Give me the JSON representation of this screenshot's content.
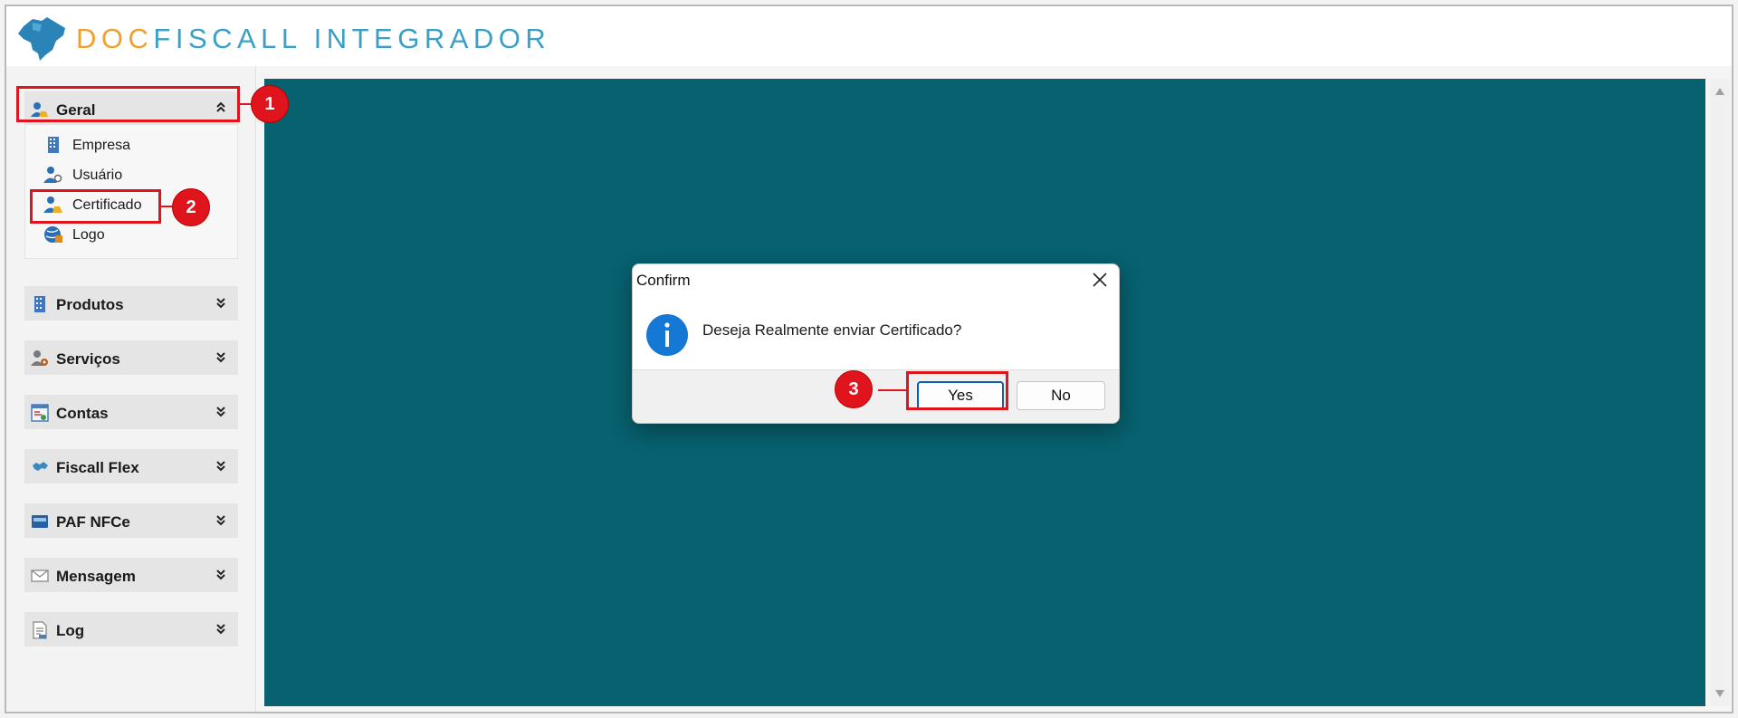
{
  "app": {
    "brand_accent": "DOC",
    "brand_rest": "FISCALL INTEGRADOR",
    "colors": {
      "accent_orange": "#f0a02c",
      "accent_blue": "#3aa0c6",
      "workspace": "#07616f",
      "callout_red": "#e0141d"
    }
  },
  "sidebar": {
    "groups": [
      {
        "label": "Geral",
        "icon": "users-icon",
        "expanded": true
      },
      {
        "label": "Produtos",
        "icon": "building-icon",
        "expanded": false
      },
      {
        "label": "Serviços",
        "icon": "user-gear-icon",
        "expanded": false
      },
      {
        "label": "Contas",
        "icon": "invoice-icon",
        "expanded": false
      },
      {
        "label": "Fiscall Flex",
        "icon": "map-icon",
        "expanded": false
      },
      {
        "label": "PAF NFCe",
        "icon": "nfce-icon",
        "expanded": false
      },
      {
        "label": "Mensagem",
        "icon": "envelope-icon",
        "expanded": false
      },
      {
        "label": "Log",
        "icon": "document-icon",
        "expanded": false
      }
    ],
    "geral_items": [
      {
        "label": "Empresa",
        "icon": "building-icon"
      },
      {
        "label": "Usuário",
        "icon": "user-search-icon"
      },
      {
        "label": "Certificado",
        "icon": "certificate-user-icon"
      },
      {
        "label": "Logo",
        "icon": "globe-icon"
      }
    ]
  },
  "dialog": {
    "title": "Confirm",
    "message": "Deseja Realmente enviar Certificado?",
    "yes_label": "Yes",
    "no_label": "No"
  },
  "callouts": {
    "step1": "1",
    "step2": "2",
    "step3": "3"
  }
}
